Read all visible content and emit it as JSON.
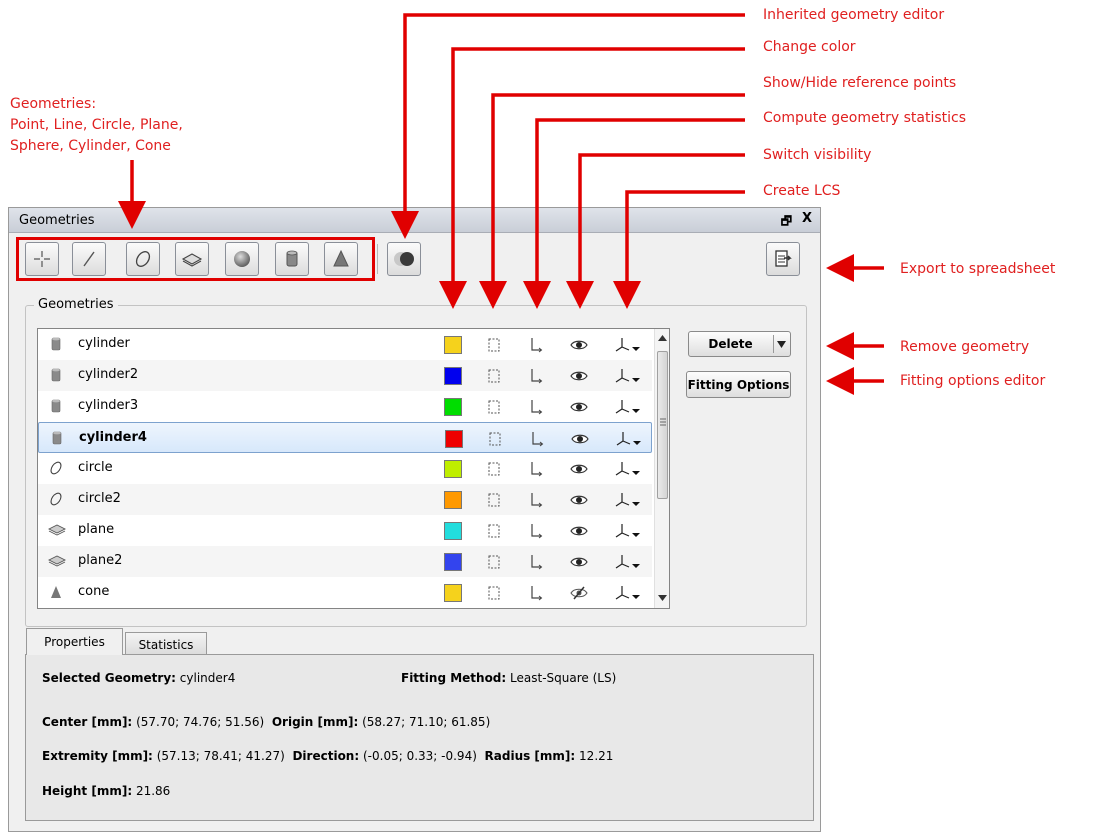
{
  "annotations": {
    "inherited": "Inherited geometry editor",
    "change_color": "Change color",
    "ref_points": "Show/Hide reference points",
    "statistics": "Compute geometry statistics",
    "visibility": "Switch visibility",
    "lcs": "Create LCS",
    "geometries_line1": "Geometries:",
    "geometries_line2": "Point, Line, Circle, Plane,",
    "geometries_line3": "Sphere, Cylinder, Cone",
    "export": "Export to spreadsheet",
    "remove": "Remove geometry",
    "fitting": "Fitting options editor"
  },
  "panel": {
    "title": "Geometries",
    "float_glyph": "🗗",
    "close_glyph": "X",
    "group_label": "Geometries"
  },
  "toolbar": {
    "icons": [
      "point-icon",
      "line-icon",
      "circle-icon",
      "plane-icon",
      "sphere-icon",
      "cylinder-icon",
      "cone-icon",
      "inherited-geometry-icon",
      "export-spreadsheet-icon"
    ]
  },
  "geometries": [
    {
      "name": "cylinder",
      "icon": "cylinder-icon",
      "color": "#f5d21c",
      "visible": true
    },
    {
      "name": "cylinder2",
      "icon": "cylinder-icon",
      "color": "#0000ee",
      "visible": true
    },
    {
      "name": "cylinder3",
      "icon": "cylinder-icon",
      "color": "#00dd00",
      "visible": true
    },
    {
      "name": "cylinder4",
      "icon": "cylinder-icon",
      "color": "#ee0000",
      "visible": true,
      "selected": true
    },
    {
      "name": "circle",
      "icon": "circle-icon",
      "color": "#bfee00",
      "visible": true
    },
    {
      "name": "circle2",
      "icon": "circle-icon",
      "color": "#ff9900",
      "visible": true
    },
    {
      "name": "plane",
      "icon": "plane-icon",
      "color": "#22dddd",
      "visible": true
    },
    {
      "name": "plane2",
      "icon": "plane-icon",
      "color": "#3344ee",
      "visible": true
    },
    {
      "name": "cone",
      "icon": "cone-icon",
      "color": "#f5d21c",
      "visible": false
    }
  ],
  "buttons": {
    "delete": "Delete",
    "fitting": "Fitting Options"
  },
  "tabs": {
    "properties": "Properties",
    "statistics": "Statistics"
  },
  "properties": {
    "selected_label": "Selected Geometry:",
    "selected_value": "cylinder4",
    "fitting_label": "Fitting Method:",
    "fitting_value": "Least-Square (LS)",
    "center_label": "Center [mm]:",
    "center_value": "(57.70; 74.76; 51.56)",
    "origin_label": "Origin [mm]:",
    "origin_value": "(58.27; 71.10; 61.85)",
    "extremity_label": "Extremity [mm]:",
    "extremity_value": "(57.13; 78.41; 41.27)",
    "direction_label": "Direction:",
    "direction_value": "(-0.05; 0.33; -0.94)",
    "radius_label": "Radius [mm]:",
    "radius_value": "12.21",
    "height_label": "Height [mm]:",
    "height_value": "21.86"
  },
  "colors": {
    "annotation": "#e02020",
    "selection_border": "#7da2ce"
  }
}
